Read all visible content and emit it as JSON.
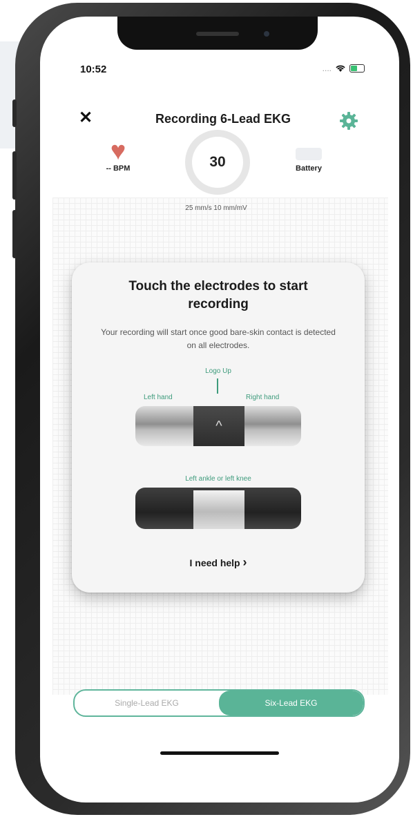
{
  "status_bar": {
    "time": "10:52",
    "signal": "....",
    "wifi_icon": "wifi-icon"
  },
  "nav": {
    "close": "✕",
    "title": "Recording 6-Lead EKG",
    "settings_icon": "gear-icon"
  },
  "stats": {
    "heart_rate": "-- BPM",
    "timer": "30",
    "battery_label": "Battery",
    "scale": "25 mm/s  10 mm/mV"
  },
  "card": {
    "title": "Touch the electrodes to start recording",
    "body": "Your recording will start once good bare-skin contact is detected on all electrodes.",
    "logo_up": "Logo Up",
    "left_hand": "Left hand",
    "right_hand": "Right hand",
    "device_arrow": "^",
    "ankle": "Left ankle or left knee",
    "help": "I need help"
  },
  "segment": {
    "options": [
      "Single-Lead EKG",
      "Six-Lead EKG"
    ],
    "selected": "Six-Lead EKG"
  },
  "colors": {
    "accent": "#5ab497",
    "heart": "#d76b60"
  }
}
